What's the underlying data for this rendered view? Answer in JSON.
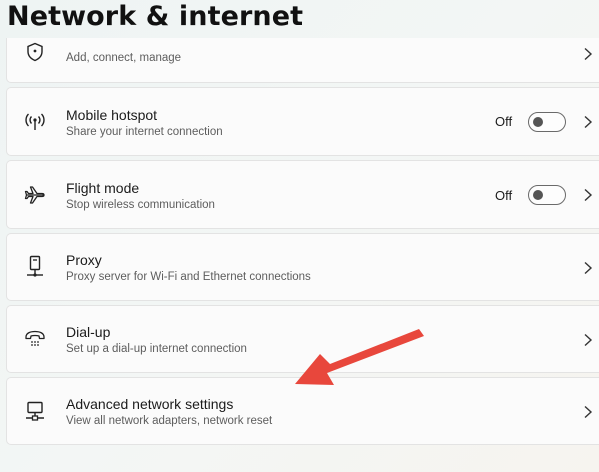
{
  "page": {
    "title": "Network & internet"
  },
  "items": [
    {
      "label": "",
      "description": "Add, connect, manage",
      "icon": "shield-icon"
    },
    {
      "label": "Mobile hotspot",
      "description": "Share your internet connection",
      "icon": "hotspot-icon",
      "toggle_label": "Off",
      "toggle_on": false
    },
    {
      "label": "Flight mode",
      "description": "Stop wireless communication",
      "icon": "airplane-icon",
      "toggle_label": "Off",
      "toggle_on": false
    },
    {
      "label": "Proxy",
      "description": "Proxy server for Wi-Fi and Ethernet connections",
      "icon": "proxy-icon"
    },
    {
      "label": "Dial-up",
      "description": "Set up a dial-up internet connection",
      "icon": "dialup-phone-icon"
    },
    {
      "label": "Advanced network settings",
      "description": "View all network adapters, network reset",
      "icon": "network-computer-icon"
    }
  ],
  "annotation": {
    "arrow_color": "#e8473c"
  }
}
